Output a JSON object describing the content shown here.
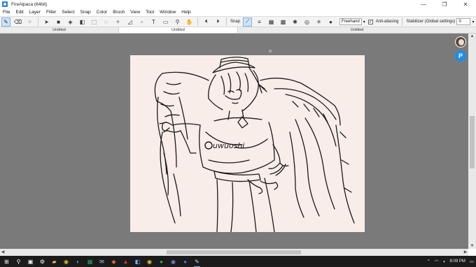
{
  "window": {
    "title": "FireAlpaca (64bit)",
    "controls": [
      "—",
      "❐",
      "✕"
    ]
  },
  "menu": [
    "File",
    "Edit",
    "Layer",
    "Filter",
    "Select",
    "Snap",
    "Color",
    "Brush",
    "View",
    "Tool",
    "Window",
    "Help"
  ],
  "toolbar": {
    "snap_label": "Snap",
    "brush_mode": "Freehand",
    "antialias_label": "Anti-aliasing",
    "antialias_checked": true,
    "antialias_mark": "✓",
    "stabilizer_label": "Stabilizer (Global settings)",
    "stabilizer_value": "0",
    "dropdown_arrow": "▾"
  },
  "tabs": [
    "Untitled",
    "Untitled",
    "Untitled"
  ],
  "active_tab_index": 1,
  "canvas": {
    "signature": "uwuoshi",
    "background_color": "#f9ede9",
    "workspace_color": "#7a7a7a"
  },
  "side": {
    "badge_letter": "P"
  },
  "taskbar": {
    "start_icon": "windows-logo-icon",
    "time": "8:09 PM",
    "tray_icons": [
      "up-chevron-icon",
      "wifi-icon",
      "volume-icon",
      "notification-icon"
    ]
  },
  "colors": {
    "accent": "#2b7de1",
    "taskbar": "#1b1b1b",
    "toolbar": "#f3f3f3"
  }
}
